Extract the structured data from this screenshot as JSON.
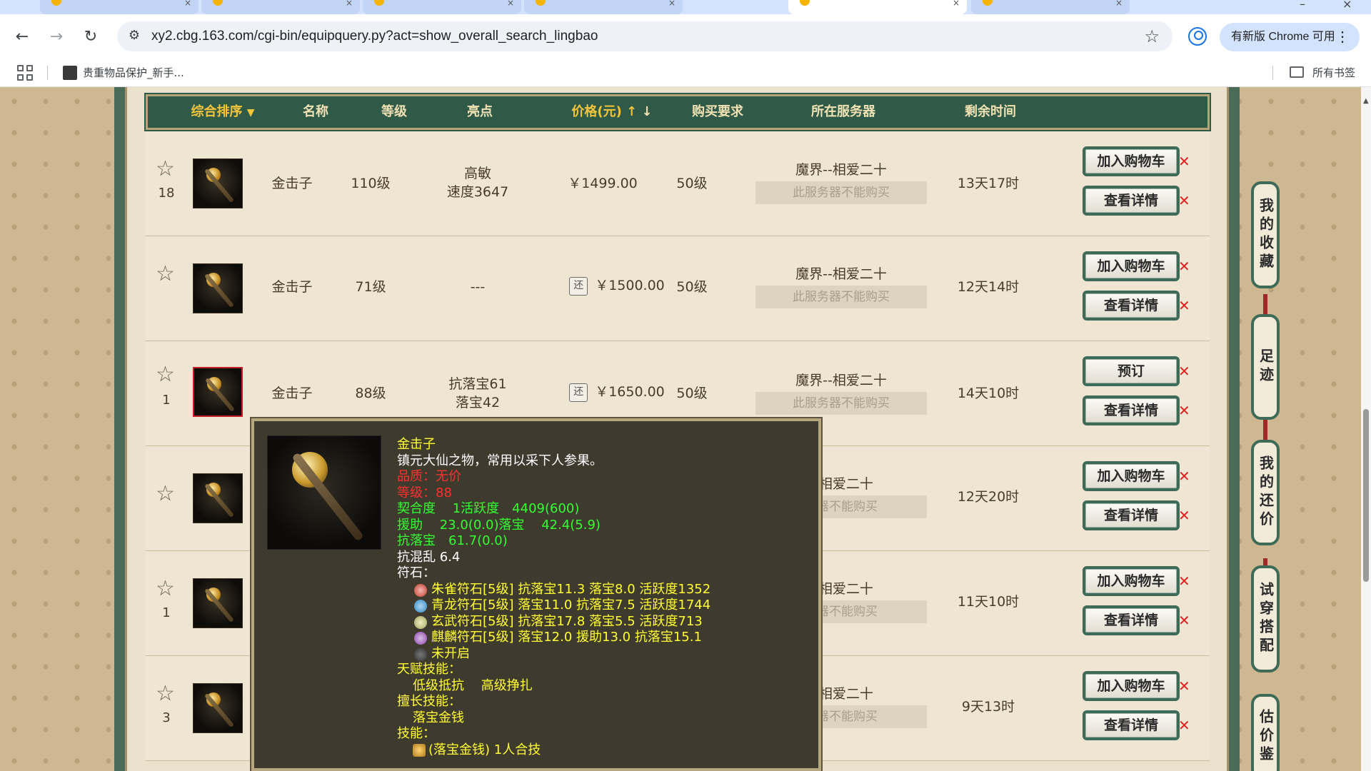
{
  "browser": {
    "url": "xy2.cbg.163.com/cgi-bin/equipquery.py?act=show_overall_search_lingbao",
    "update_label": "有新版 Chrome 可用",
    "bookmark_label": "贵重物品保护_新手...",
    "all_bookmarks_label": "所有书签"
  },
  "table": {
    "headers": [
      "综合排序",
      "名称",
      "等级",
      "亮点",
      "价格(元)",
      "购买要求",
      "所在服务器",
      "剩余时间"
    ],
    "sort_arrow": "▼",
    "price_up": "↑",
    "price_down": "↓",
    "unbuyable_text": "此服务器不能购买",
    "rows": [
      {
        "count": "18",
        "name": "金击子",
        "level": "110级",
        "highlight1": "高敏",
        "highlight2": "速度3647",
        "price": "￥1499.00",
        "has_price_icon": false,
        "req": "50级",
        "server": "魔界--相爱二十",
        "time": "13天17时",
        "btn1": "加入购物车",
        "btn2": "查看详情"
      },
      {
        "count": "",
        "name": "金击子",
        "level": "71级",
        "highlight1": "---",
        "highlight2": "",
        "price": "￥1500.00",
        "has_price_icon": true,
        "req": "50级",
        "server": "魔界--相爱二十",
        "time": "12天14时",
        "btn1": "加入购物车",
        "btn2": "查看详情"
      },
      {
        "count": "1",
        "name": "金击子",
        "level": "88级",
        "highlight1": "抗落宝61",
        "highlight2": "落宝42",
        "price": "￥1650.00",
        "has_price_icon": true,
        "req": "50级",
        "server": "魔界--相爱二十",
        "time": "14天10时",
        "btn1": "预订",
        "btn2": "查看详情"
      },
      {
        "count": "",
        "name": "",
        "level": "",
        "highlight1": "",
        "highlight2": "",
        "price": "",
        "has_price_icon": false,
        "req": "",
        "server": "--相爱二十",
        "time": "12天20时",
        "btn1": "加入购物车",
        "btn2": "查看详情"
      },
      {
        "count": "1",
        "name": "",
        "level": "",
        "highlight1": "",
        "highlight2": "",
        "price": "",
        "has_price_icon": false,
        "req": "",
        "server": "--相爱二十",
        "time": "11天10时",
        "btn1": "加入购物车",
        "btn2": "查看详情"
      },
      {
        "count": "3",
        "name": "",
        "level": "",
        "highlight1": "",
        "highlight2": "",
        "price": "",
        "has_price_icon": false,
        "req": "",
        "server": "--相爱二十",
        "time": "9天13时",
        "btn1": "加入购物车",
        "btn2": "查看详情"
      }
    ],
    "partial_unbuyable_text": "务器不能购买",
    "price_icon_glyph": "还",
    "close_glyph": "✕"
  },
  "popup": {
    "name": "金击子",
    "desc": "镇元大仙之物，常用以采下人参果。",
    "quality": "品质：无价",
    "level": "等级：88",
    "line_fit": "契合度　  1活跃度　4409(600)",
    "line_assist": "援助　  23.0(0.0)落宝　  42.4(5.9)",
    "line_anti": "抗落宝　61.7(0.0)",
    "line_chaos": "抗混乱 6.4",
    "runes_title": "符石：",
    "runes": [
      {
        "text": "朱雀符石[5级] 抗落宝11.3 落宝8.0 活跃度1352",
        "color": "#c0392b"
      },
      {
        "text": "青龙符石[5级] 落宝11.0 抗落宝7.5 活跃度1744",
        "color": "#2e86c1"
      },
      {
        "text": "玄武符石[5级] 抗落宝17.8 落宝5.5 活跃度713",
        "color": "#a0a060"
      },
      {
        "text": "麒麟符石[5级] 落宝12.0 援助13.0 抗落宝15.1",
        "color": "#8e44ad"
      },
      {
        "text": "未开启",
        "color": "#555555"
      }
    ],
    "talent_title": "天赋技能：",
    "talent_skills": "低级抵抗　  高级挣扎",
    "expert_title": "擅长技能：",
    "expert_skill": "落宝金钱",
    "skill_title": "技能：",
    "skill_line": "(落宝金钱) 1人合技"
  },
  "side_panel": {
    "tabs": [
      "我的收藏",
      "足迹",
      "我的还价",
      "试穿搭配",
      "估价鉴"
    ]
  }
}
